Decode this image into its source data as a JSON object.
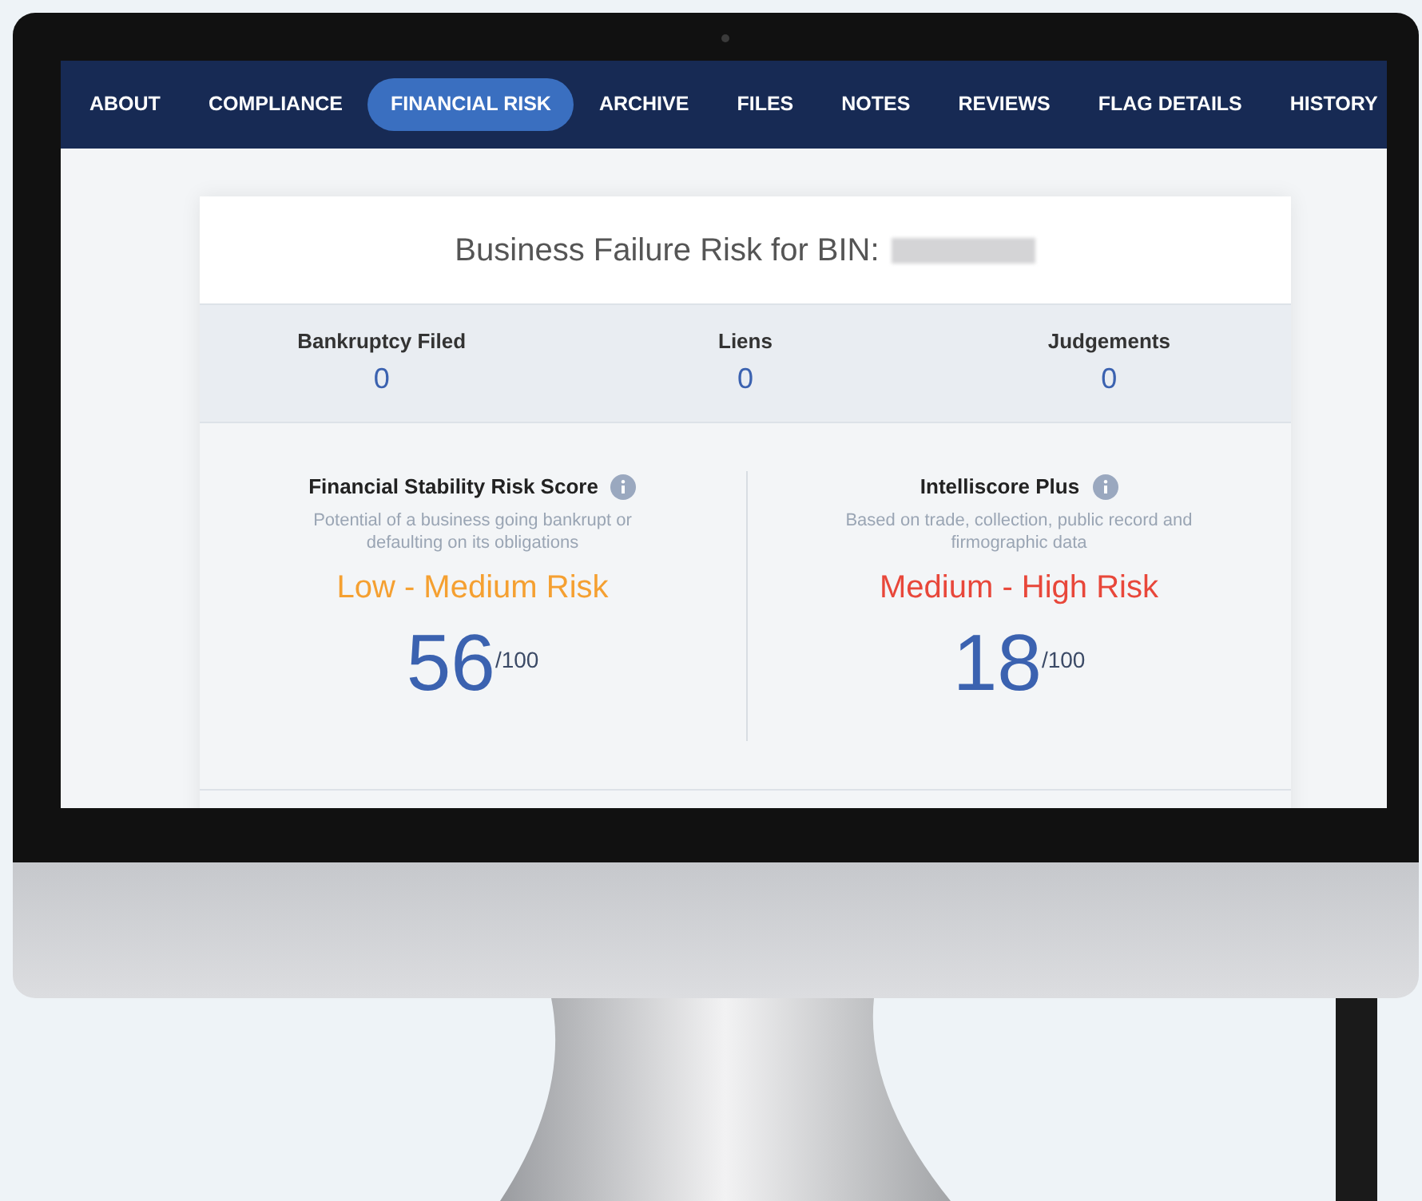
{
  "tabs": [
    {
      "label": "ABOUT",
      "selected": false
    },
    {
      "label": "COMPLIANCE",
      "selected": false
    },
    {
      "label": "FINANCIAL RISK",
      "selected": true
    },
    {
      "label": "ARCHIVE",
      "selected": false
    },
    {
      "label": "FILES",
      "selected": false
    },
    {
      "label": "NOTES",
      "selected": false
    },
    {
      "label": "REVIEWS",
      "selected": false
    },
    {
      "label": "FLAG DETAILS",
      "selected": false
    },
    {
      "label": "HISTORY",
      "selected": false
    }
  ],
  "card": {
    "title": "Business Failure Risk for BIN:",
    "stats": [
      {
        "label": "Bankruptcy Filed",
        "value": "0"
      },
      {
        "label": "Liens",
        "value": "0"
      },
      {
        "label": "Judgements",
        "value": "0"
      }
    ],
    "scores": [
      {
        "title": "Financial Stability Risk Score",
        "description": "Potential of a business going bankrupt or defaulting on its obligations",
        "risk": "Low - Medium Risk",
        "color": "#f5a031",
        "score": "56",
        "scale": "/100"
      },
      {
        "title": "Intelliscore Plus",
        "description": "Based on trade, collection, public record and firmographic data",
        "risk": "Medium - High Risk",
        "color": "#e8473a",
        "score": "18",
        "scale": "/100"
      }
    ]
  }
}
